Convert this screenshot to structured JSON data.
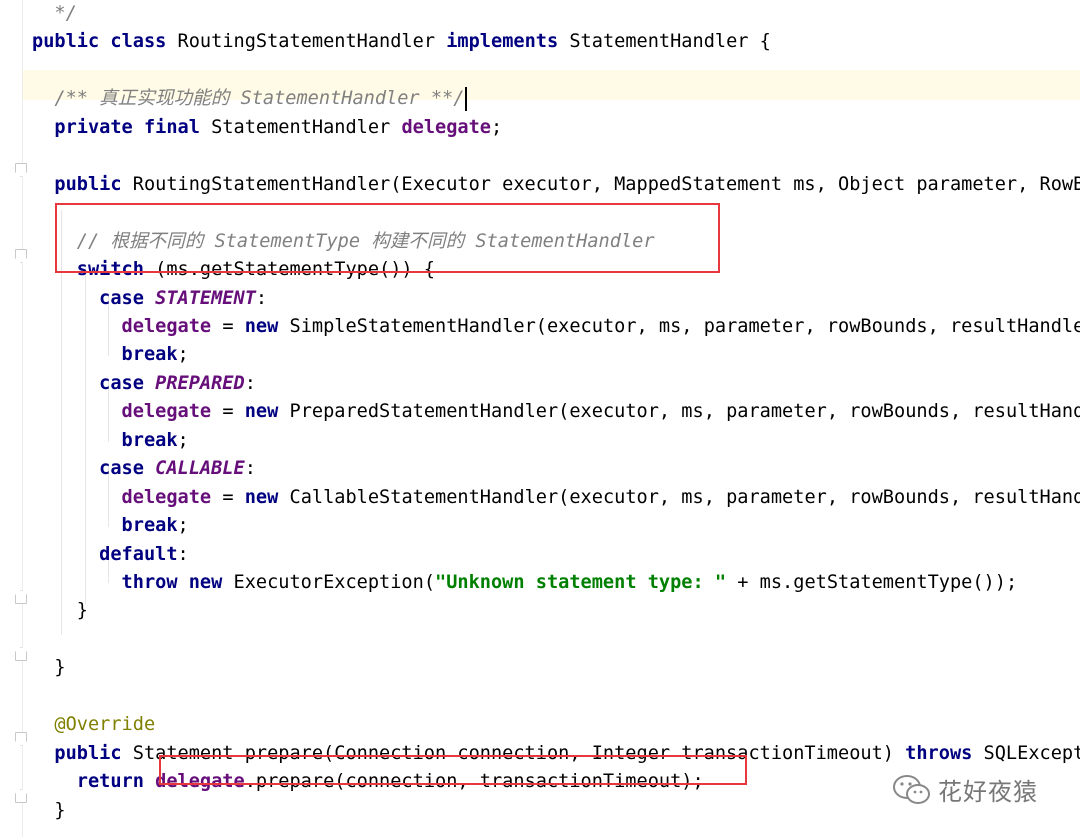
{
  "editor": {
    "lines": [
      {
        "id": "l0",
        "segments": [
          {
            "t": "  */",
            "c": "cmt"
          }
        ]
      },
      {
        "id": "l1",
        "segments": [
          {
            "t": "public ",
            "c": "kw"
          },
          {
            "t": "class ",
            "c": "kw"
          },
          {
            "t": "RoutingStatementHandler ",
            "c": ""
          },
          {
            "t": "implements ",
            "c": "kw"
          },
          {
            "t": "StatementHandler {",
            "c": ""
          }
        ]
      },
      {
        "id": "l2",
        "segments": []
      },
      {
        "id": "l3",
        "segments": [
          {
            "t": "  /** 真正实现功能的 StatementHandler **/",
            "c": "cmt"
          }
        ]
      },
      {
        "id": "l4",
        "segments": [
          {
            "t": "  private ",
            "c": "kw"
          },
          {
            "t": "final ",
            "c": "kw"
          },
          {
            "t": "StatementHandler ",
            "c": ""
          },
          {
            "t": "delegate",
            "c": "fld"
          },
          {
            "t": ";",
            "c": ""
          }
        ]
      },
      {
        "id": "l5",
        "segments": []
      },
      {
        "id": "l6",
        "segments": [
          {
            "t": "  public ",
            "c": "kw"
          },
          {
            "t": "RoutingStatementHandler(Executor executor, MappedStatement ms, Object parameter, RowBounds rowBounds, ResultHandler resultHandler, BoundSql boundSql) {",
            "c": ""
          }
        ]
      },
      {
        "id": "l7",
        "segments": []
      },
      {
        "id": "l8",
        "segments": [
          {
            "t": "    // 根据不同的 StatementType 构建不同的 StatementHandler",
            "c": "cmt"
          }
        ]
      },
      {
        "id": "l9",
        "segments": [
          {
            "t": "    switch ",
            "c": "kw"
          },
          {
            "t": "(ms.getStatementType()) {",
            "c": ""
          }
        ]
      },
      {
        "id": "l10",
        "segments": [
          {
            "t": "      case ",
            "c": "kw"
          },
          {
            "t": "STATEMENT",
            "c": "const"
          },
          {
            "t": ":",
            "c": ""
          }
        ]
      },
      {
        "id": "l11",
        "segments": [
          {
            "t": "        delegate",
            "c": "fld"
          },
          {
            "t": " = ",
            "c": ""
          },
          {
            "t": "new ",
            "c": "kw"
          },
          {
            "t": "SimpleStatementHandler(executor, ms, parameter, rowBounds, resultHandler, boundSql);",
            "c": ""
          }
        ]
      },
      {
        "id": "l12",
        "segments": [
          {
            "t": "        break",
            "c": "kw"
          },
          {
            "t": ";",
            "c": ""
          }
        ]
      },
      {
        "id": "l13",
        "segments": [
          {
            "t": "      case ",
            "c": "kw"
          },
          {
            "t": "PREPARED",
            "c": "const"
          },
          {
            "t": ":",
            "c": ""
          }
        ]
      },
      {
        "id": "l14",
        "segments": [
          {
            "t": "        delegate",
            "c": "fld"
          },
          {
            "t": " = ",
            "c": ""
          },
          {
            "t": "new ",
            "c": "kw"
          },
          {
            "t": "PreparedStatementHandler(executor, ms, parameter, rowBounds, resultHandler, boundSql);",
            "c": ""
          }
        ]
      },
      {
        "id": "l15",
        "segments": [
          {
            "t": "        break",
            "c": "kw"
          },
          {
            "t": ";",
            "c": ""
          }
        ]
      },
      {
        "id": "l16",
        "segments": [
          {
            "t": "      case ",
            "c": "kw"
          },
          {
            "t": "CALLABLE",
            "c": "const"
          },
          {
            "t": ":",
            "c": ""
          }
        ]
      },
      {
        "id": "l17",
        "segments": [
          {
            "t": "        delegate",
            "c": "fld"
          },
          {
            "t": " = ",
            "c": ""
          },
          {
            "t": "new ",
            "c": "kw"
          },
          {
            "t": "CallableStatementHandler(executor, ms, parameter, rowBounds, resultHandler, boundSql);",
            "c": ""
          }
        ]
      },
      {
        "id": "l18",
        "segments": [
          {
            "t": "        break",
            "c": "kw"
          },
          {
            "t": ";",
            "c": ""
          }
        ]
      },
      {
        "id": "l19",
        "segments": [
          {
            "t": "      default",
            "c": "kw"
          },
          {
            "t": ":",
            "c": ""
          }
        ]
      },
      {
        "id": "l20",
        "segments": [
          {
            "t": "        throw ",
            "c": "kw"
          },
          {
            "t": "new ",
            "c": "kw"
          },
          {
            "t": "ExecutorException(",
            "c": ""
          },
          {
            "t": "\"Unknown statement type: \"",
            "c": "str"
          },
          {
            "t": " + ms.getStatementType());",
            "c": ""
          }
        ]
      },
      {
        "id": "l21",
        "segments": [
          {
            "t": "    }",
            "c": ""
          }
        ]
      },
      {
        "id": "l22",
        "segments": []
      },
      {
        "id": "l23",
        "segments": [
          {
            "t": "  }",
            "c": ""
          }
        ]
      },
      {
        "id": "l24",
        "segments": []
      },
      {
        "id": "l25",
        "segments": [
          {
            "t": "  @Override",
            "c": "ann"
          }
        ]
      },
      {
        "id": "l26",
        "segments": [
          {
            "t": "  public ",
            "c": "kw"
          },
          {
            "t": "Statement prepare(Connection connection, Integer transactionTimeout) ",
            "c": ""
          },
          {
            "t": "throws ",
            "c": "kw"
          },
          {
            "t": "SQLException {",
            "c": ""
          }
        ]
      },
      {
        "id": "l27",
        "segments": [
          {
            "t": "    return ",
            "c": "kw"
          },
          {
            "t": "delegate",
            "c": "fld"
          },
          {
            "t": ".prepare(connection, transactionTimeout);",
            "c": ""
          }
        ]
      },
      {
        "id": "l28",
        "segments": [
          {
            "t": "  }",
            "c": ""
          }
        ]
      }
    ]
  },
  "watermark": {
    "text": "花好夜猿",
    "icon": "wechat-icon"
  },
  "colors": {
    "keyword": "#000080",
    "comment": "#808080",
    "field": "#660e7a",
    "string": "#008000",
    "annotation": "#808000",
    "highlight_box": "#e8383d"
  }
}
